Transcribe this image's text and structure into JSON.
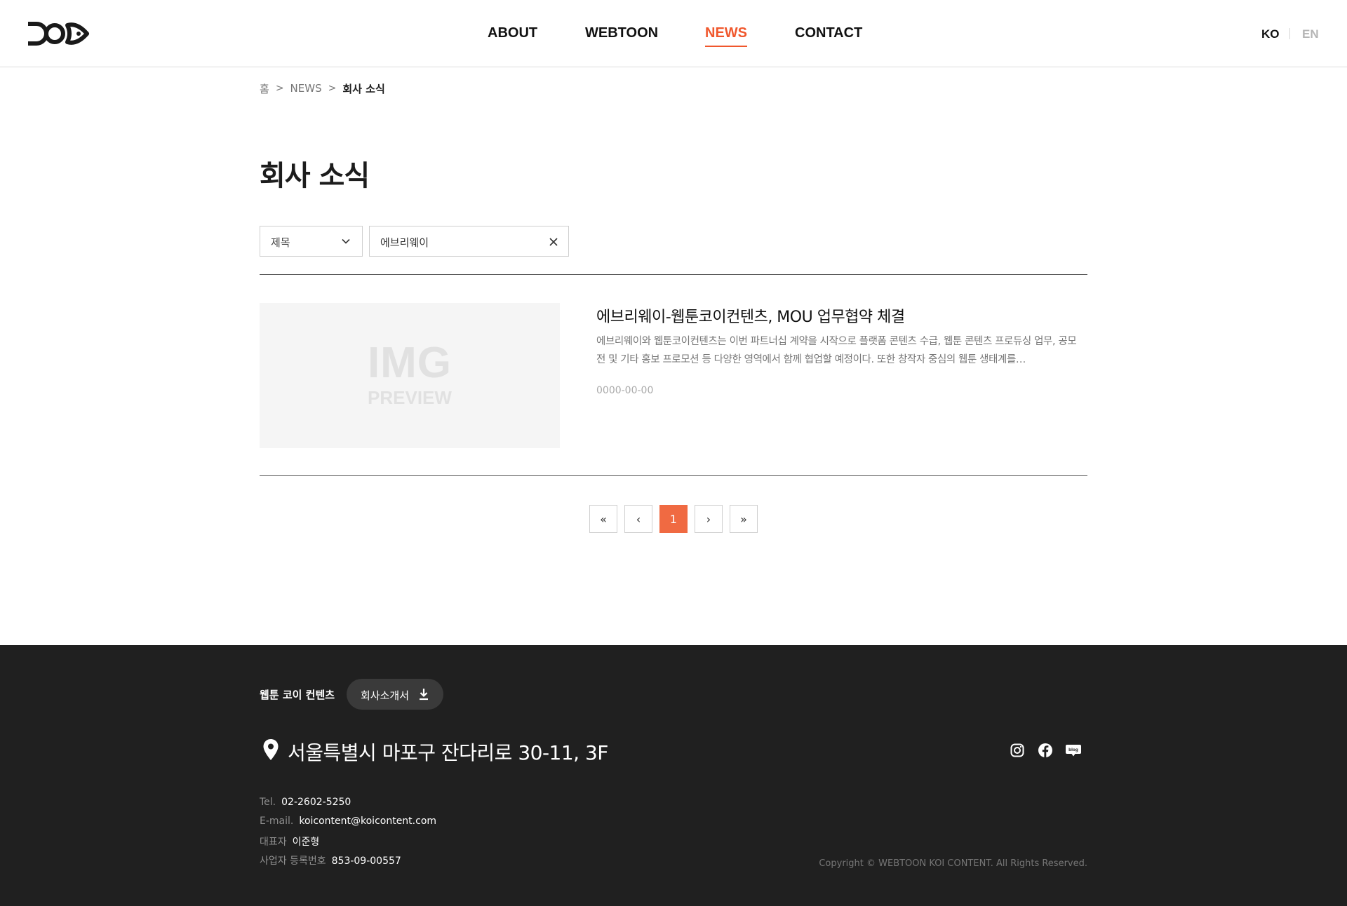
{
  "header": {
    "logo_alt": "KOI",
    "nav": [
      {
        "label": "ABOUT"
      },
      {
        "label": "WEBTOON"
      },
      {
        "label": "NEWS"
      },
      {
        "label": "CONTACT"
      }
    ],
    "active_nav": "NEWS",
    "lang": {
      "ko": "KO",
      "en": "EN"
    }
  },
  "breadcrumb": {
    "home": "홈",
    "sep": ">",
    "section": "NEWS",
    "current": "회사 소식"
  },
  "page_title": "회사 소식",
  "search": {
    "field_selected": "제목",
    "query": "에브리웨이"
  },
  "articles": [
    {
      "thumb_line1": "IMG",
      "thumb_line2": "PREVIEW",
      "title": "에브리웨이-웹툰코이컨텐츠, MOU 업무협약 체결",
      "body": "에브리웨이와 웹툰코이컨텐츠는 이번 파트너십 계약을 시작으로 플랫폼 콘텐츠 수급, 웹툰 콘텐츠 프로듀싱 업무, 공모전 및 기타 홍보 프로모션 등 다양한 영역에서 함께 협업할 예정이다. 또한 창작자 중심의 웹툰 생태계를…",
      "date": "0000-00-00"
    }
  ],
  "pagination": {
    "first": "«",
    "prev": "‹",
    "current": "1",
    "next": "›",
    "last": "»"
  },
  "footer": {
    "company": "웹툰 코이 컨텐츠",
    "download_label": "회사소개서",
    "address": "서울특별시 마포구 잔다리로 30-11, 3F",
    "tel_key": "Tel.",
    "tel": "02-2602-5250",
    "email_key": "E-mail.",
    "email": "koicontent@koicontent.com",
    "ceo_key": "대표자",
    "ceo": "이준형",
    "biz_key": "사업자 등록번호",
    "biz": "853-09-00557",
    "copyright": "Copyright © WEBTOON KOI CONTENT. All Rights Reserved.",
    "social": [
      "instagram-icon",
      "facebook-icon",
      "blog-icon"
    ]
  },
  "colors": {
    "accent": "#f0572c",
    "footer_bg": "#202020",
    "pager_active": "#f06a42"
  }
}
